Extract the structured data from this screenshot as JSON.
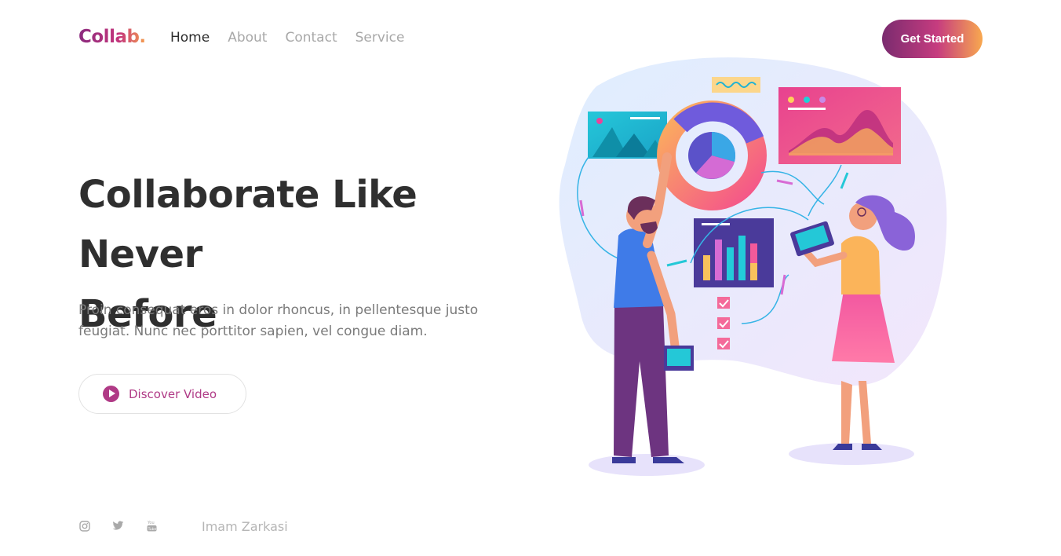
{
  "brand": {
    "logo": "Collab."
  },
  "nav": {
    "items": [
      {
        "label": "Home",
        "active": true
      },
      {
        "label": "About",
        "active": false
      },
      {
        "label": "Contact",
        "active": false
      },
      {
        "label": "Service",
        "active": false
      }
    ],
    "cta_label": "Get Started"
  },
  "hero": {
    "headline_line1": "Collaborate Like Never",
    "headline_line2": "Before",
    "subtext": "Proin consequat eros in dolor rhoncus, in pellentesque justo feugiat. Nunc nec porttitor sapien, vel congue diam.",
    "video_button_label": "Discover Video"
  },
  "footer": {
    "social_icons": [
      "instagram-icon",
      "twitter-icon",
      "youtube-icon"
    ],
    "author": "Imam Zarkasi"
  },
  "colors": {
    "brand_gradient_start": "#7a2b6f",
    "brand_gradient_mid": "#c63c7f",
    "brand_gradient_end": "#f8a84f",
    "accent": "#b03a86",
    "text_dark": "#2f2f2f",
    "text_muted": "#7a7a7a"
  }
}
